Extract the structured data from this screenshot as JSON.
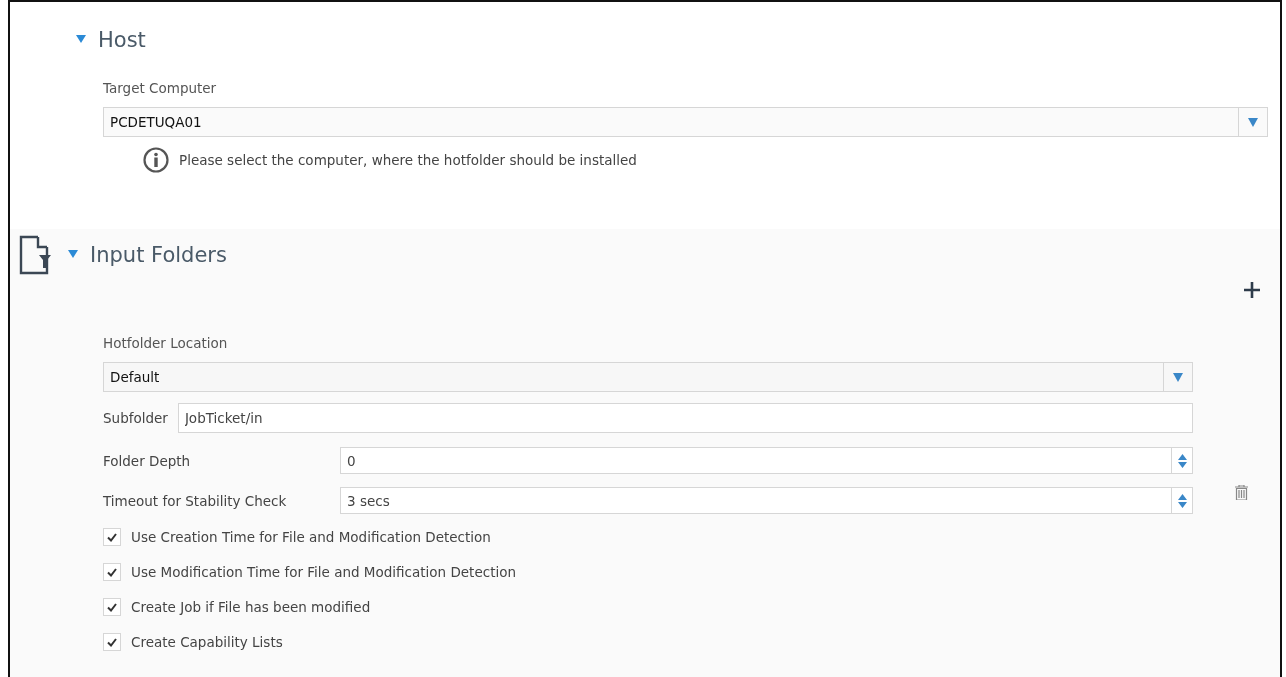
{
  "host": {
    "title": "Host",
    "expanded": true,
    "target_label": "Target Computer",
    "target_value": "PCDETUQA01",
    "info": "Please select the computer, where the hotfolder should be installed"
  },
  "input_folders": {
    "title": "Input Folders",
    "expanded": true,
    "location_label": "Hotfolder Location",
    "location_value": "Default",
    "subfolder_label": "Subfolder",
    "subfolder_value": "JobTicket/in",
    "depth_label": "Folder Depth",
    "depth_value": "0",
    "timeout_label": "Timeout for Stability Check",
    "timeout_value": "3 secs",
    "options": [
      {
        "label": "Use Creation Time for File and Modification Detection",
        "checked": true
      },
      {
        "label": "Use Modification Time for File and Modification Detection",
        "checked": true
      },
      {
        "label": "Create Job if File has been modified",
        "checked": true
      },
      {
        "label": "Create Capability Lists",
        "checked": true
      }
    ]
  }
}
